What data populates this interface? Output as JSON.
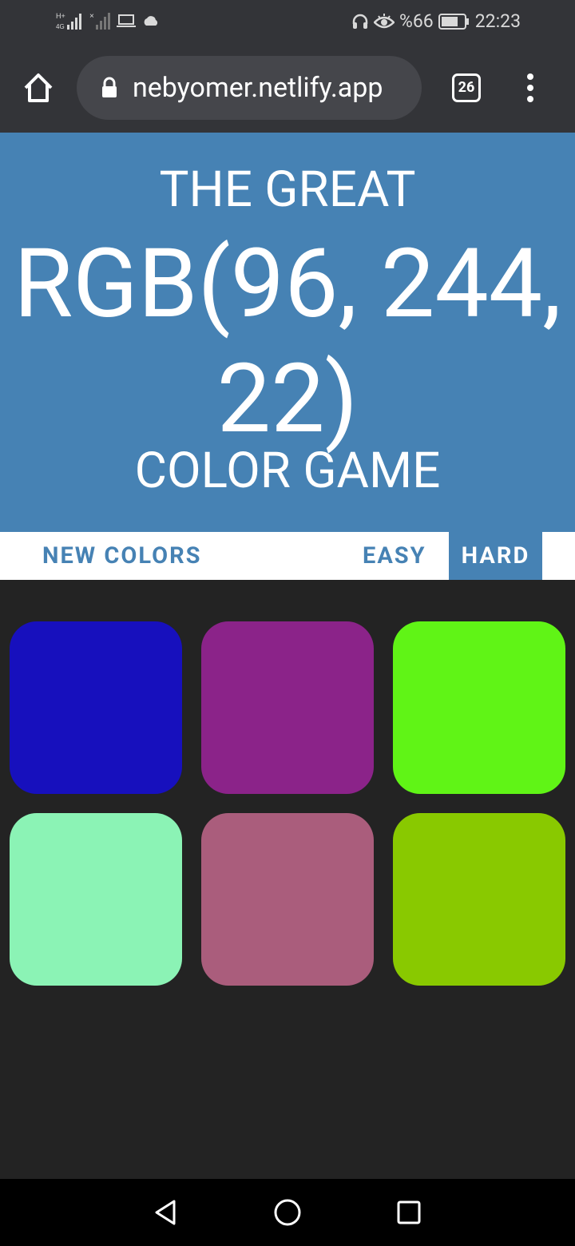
{
  "status_bar": {
    "battery_percent": "%66",
    "time": "22:23",
    "icons": [
      "signal-h-plus-icon",
      "signal-no-sim-icon",
      "laptop-icon",
      "cloud-icon",
      "headphones-icon",
      "eye-icon",
      "battery-icon"
    ]
  },
  "browser": {
    "url": "nebyomer.netlify.app",
    "tab_count": "26",
    "icons": [
      "home-icon",
      "lock-icon",
      "tabs-icon",
      "menu-dots-icon"
    ]
  },
  "header": {
    "line1": "THE GREAT",
    "rgb_display": "RGB(96, 244, 22)",
    "line3": "COLOR GAME",
    "background": "#4682b4"
  },
  "controls": {
    "new_colors_label": "NEW COLORS",
    "easy_label": "EASY",
    "hard_label": "HARD",
    "selected_mode": "HARD"
  },
  "squares": [
    {
      "color": "#1710bd"
    },
    {
      "color": "#8b2389"
    },
    {
      "color": "#60f416"
    },
    {
      "color": "#8bf3b5"
    },
    {
      "color": "#aa5d7c"
    },
    {
      "color": "#89c900"
    }
  ],
  "navigation": [
    "back-icon",
    "home-circle-icon",
    "recents-icon"
  ]
}
